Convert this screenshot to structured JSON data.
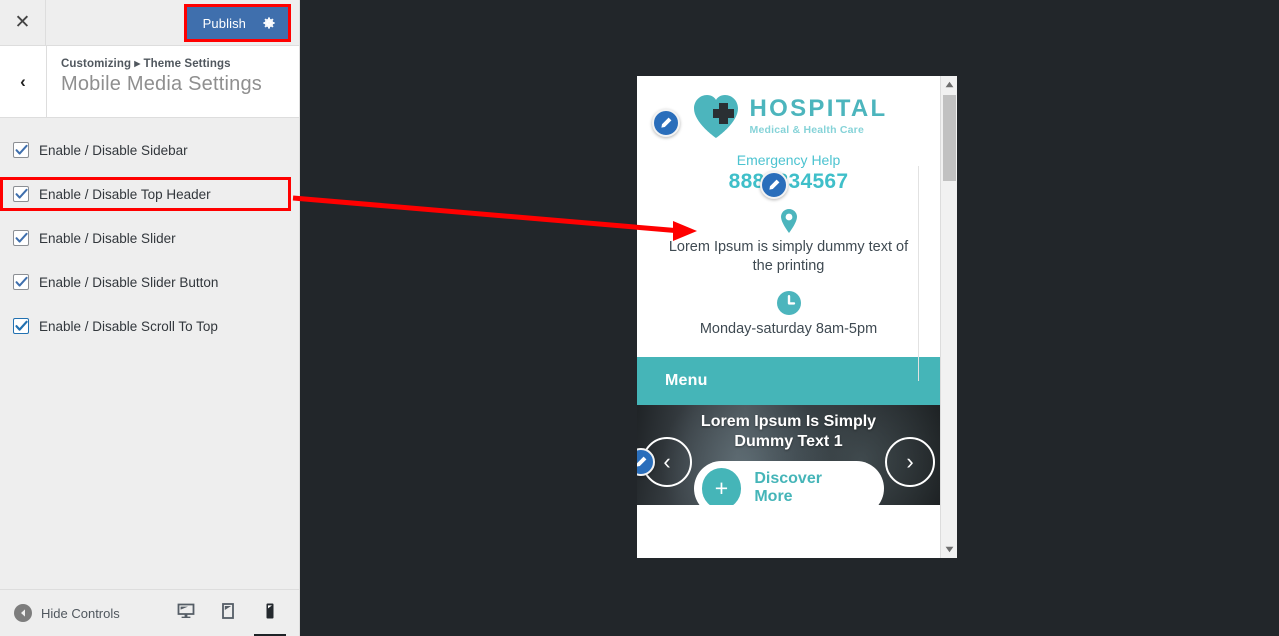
{
  "customizer": {
    "close_label": "✕",
    "publish_label": "Publish",
    "gear_icon": "gear-icon",
    "back_label": "‹",
    "breadcrumb": "Customizing ▸ Theme Settings",
    "panel_title": "Mobile Media Settings",
    "controls": [
      {
        "label": "Enable / Disable Sidebar",
        "checked": true,
        "highlighted": false
      },
      {
        "label": "Enable / Disable Top Header",
        "checked": true,
        "highlighted": true
      },
      {
        "label": "Enable / Disable Slider",
        "checked": true,
        "highlighted": false
      },
      {
        "label": "Enable / Disable Slider Button",
        "checked": true,
        "highlighted": false
      },
      {
        "label": "Enable / Disable Scroll To Top",
        "checked": true,
        "highlighted": false
      }
    ],
    "footer": {
      "hide_controls_label": "Hide Controls",
      "collapse_icon": "collapse-left-icon",
      "devices": [
        {
          "name": "desktop",
          "icon": "desktop-icon",
          "active": false
        },
        {
          "name": "tablet",
          "icon": "tablet-icon",
          "active": false
        },
        {
          "name": "mobile",
          "icon": "mobile-icon",
          "active": true
        }
      ]
    }
  },
  "preview": {
    "logo": {
      "icon": "hospital-heart-cross-icon",
      "title": "HOSPITAL",
      "subtitle": "Medical & Health Care"
    },
    "emergency": {
      "label": "Emergency Help",
      "number": "8881234567"
    },
    "address": {
      "icon": "map-pin-icon",
      "text": "Lorem Ipsum is simply dummy text of the printing"
    },
    "hours": {
      "icon": "clock-icon",
      "text": "Monday-saturday 8am-5pm"
    },
    "menu_bar": {
      "label": "Menu"
    },
    "slider": {
      "title": "Lorem Ipsum Is Simply Dummy Text 1",
      "prev_icon": "chevron-left-icon",
      "next_icon": "chevron-right-icon",
      "cta_label": "Discover More",
      "cta_plus_icon": "plus-icon"
    },
    "edit_pencils": [
      {
        "name": "edit-pencil-logo"
      },
      {
        "name": "edit-pencil-emergency"
      },
      {
        "name": "edit-pencil-slider"
      }
    ],
    "scrollbar": {
      "up_icon": "scroll-up-arrow",
      "down_icon": "scroll-down-arrow"
    }
  },
  "colors": {
    "publish_blue": "#3f6fad",
    "highlight_red": "#ff0000",
    "brand_teal": "#45b5b8",
    "logo_title_teal": "#4cb5bd",
    "logo_sub_teal": "#86d3d8",
    "phone_teal": "#3fbfc9",
    "preview_bg_dark": "#22262a",
    "sidebar_bg": "#eeeeee"
  }
}
